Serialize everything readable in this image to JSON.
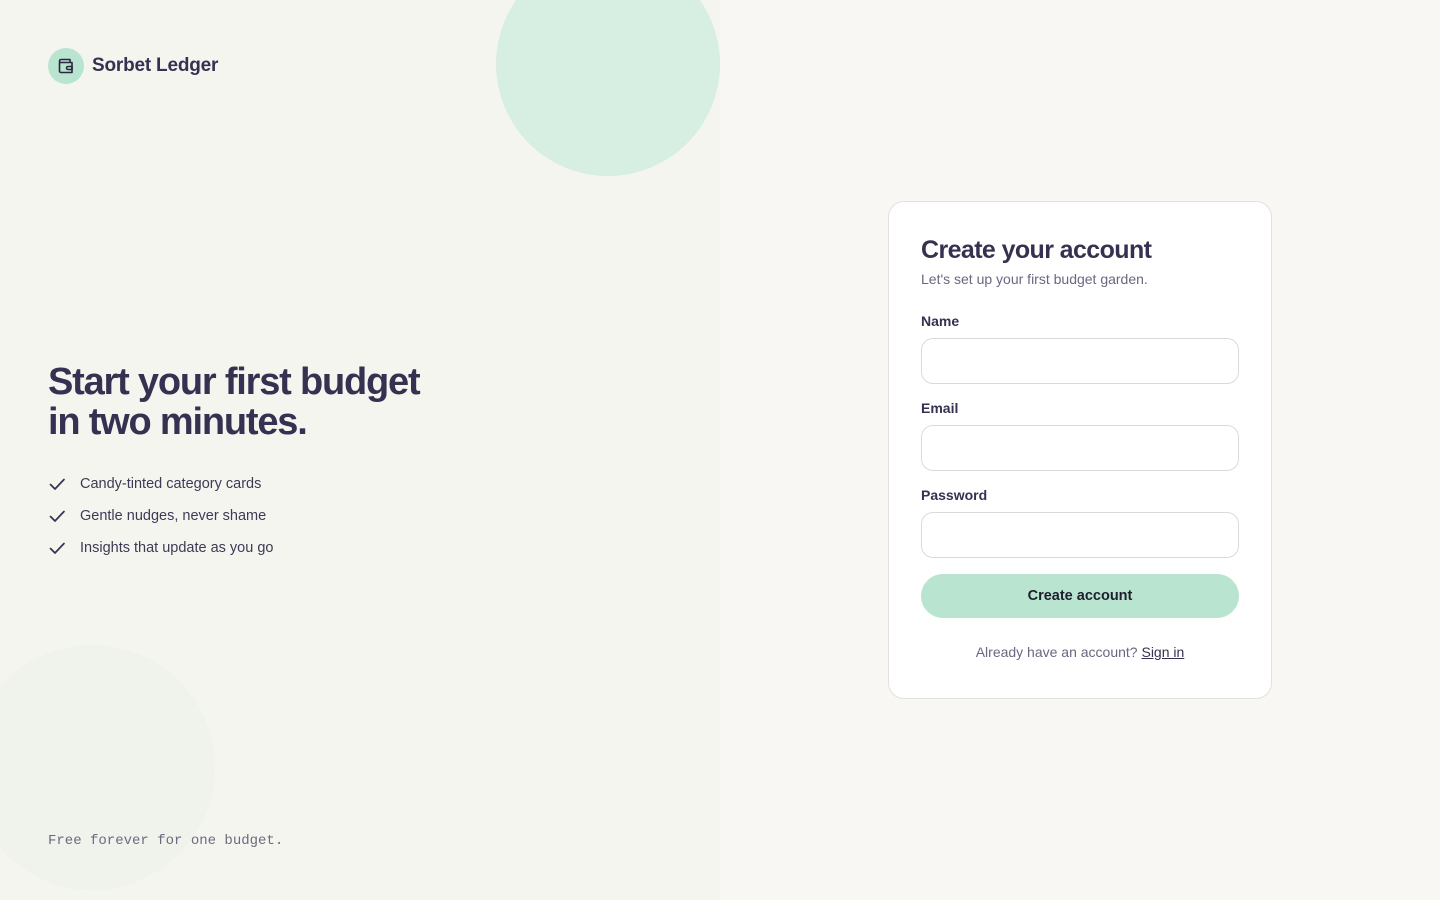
{
  "brand": {
    "name": "Sorbet Ledger",
    "icon": "wallet-icon",
    "badge_color": "#b9e4d0"
  },
  "hero": {
    "title_line1": "Start your first budget",
    "title_line2": "in two minutes.",
    "features": [
      {
        "icon": "check-icon",
        "label": "Candy-tinted category cards"
      },
      {
        "icon": "check-icon",
        "label": "Gentle nudges, never shame"
      },
      {
        "icon": "check-icon",
        "label": "Insights that update as you go"
      }
    ],
    "footnote": "Free forever for one budget."
  },
  "signup": {
    "title": "Create your account",
    "subtitle": "Let's set up your first budget garden.",
    "fields": {
      "name": {
        "label": "Name",
        "value": "",
        "placeholder": ""
      },
      "email": {
        "label": "Email",
        "value": "",
        "placeholder": ""
      },
      "password": {
        "label": "Password",
        "value": "",
        "placeholder": ""
      }
    },
    "submit_label": "Create account",
    "signin_prompt": "Already have an account?",
    "signin_link": "Sign in"
  },
  "colors": {
    "accent": "#b9e4d0",
    "text": "#363150",
    "left_bg": "#f5f5f0",
    "right_bg": "#f9f7f3"
  }
}
